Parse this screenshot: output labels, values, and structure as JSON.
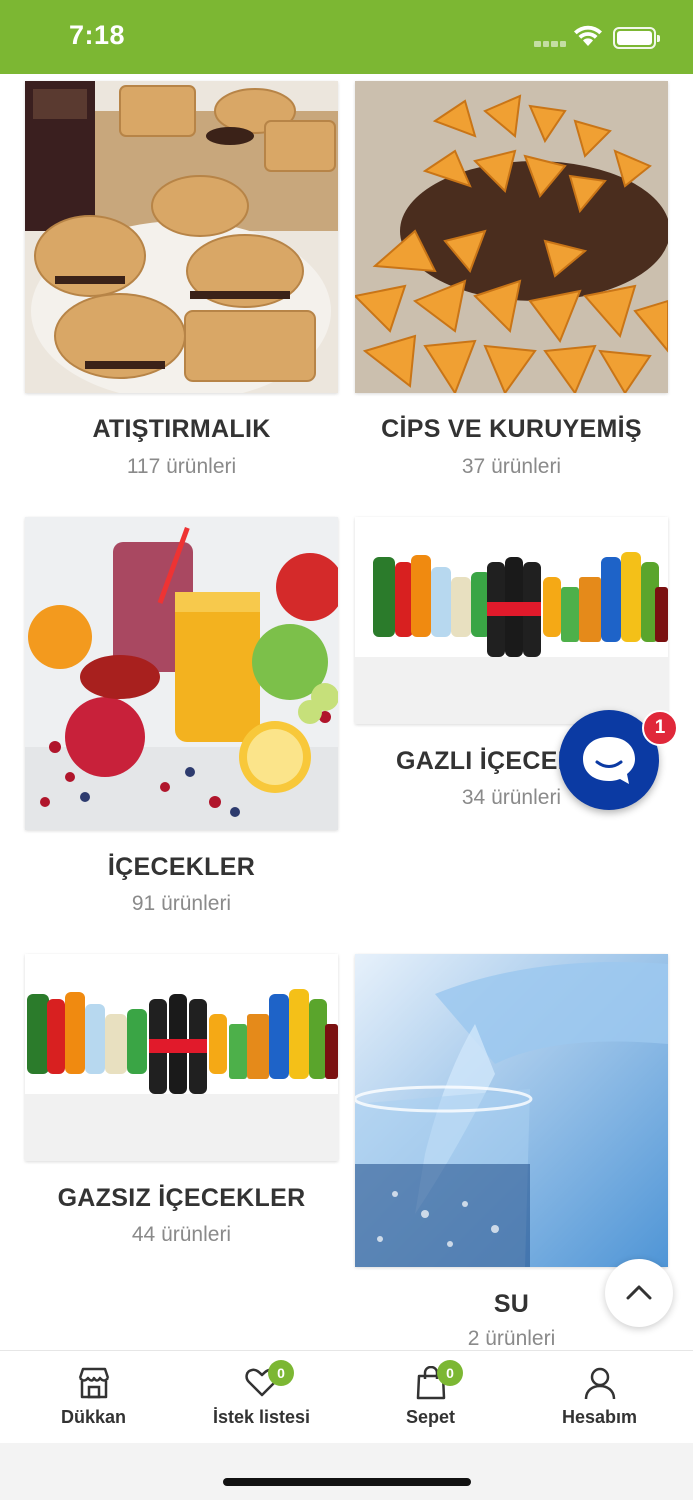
{
  "status_bar": {
    "time": "7:18"
  },
  "categories": [
    {
      "name": "ATIŞTIRMALIK",
      "count": "117 ürünleri",
      "image": "biscuits"
    },
    {
      "name": "CİPS VE KURUYEMİŞ",
      "count": "37 ürünleri",
      "image": "chips"
    },
    {
      "name": "İÇECEKLER",
      "count": "91 ürünleri",
      "image": "juices"
    },
    {
      "name": "GAZLI İÇECEKLER",
      "count": "34 ürünleri",
      "image": "soda-bottles"
    },
    {
      "name": "GAZSIZ İÇECEKLER",
      "count": "44 ürünleri",
      "image": "soda-bottles"
    },
    {
      "name": "SU",
      "count": "2 ürünleri",
      "image": "water-glass"
    }
  ],
  "chat": {
    "badge": "1"
  },
  "bottom_nav": {
    "items": [
      {
        "label": "Dükkan",
        "icon": "store-icon"
      },
      {
        "label": "İstek listesi",
        "icon": "heart-icon",
        "badge": "0"
      },
      {
        "label": "Sepet",
        "icon": "shopping-bag-icon",
        "badge": "0"
      },
      {
        "label": "Hesabım",
        "icon": "user-icon"
      }
    ]
  },
  "colors": {
    "brand": "#7cb733",
    "chat": "#0b3aa3",
    "badge_red": "#e0283a"
  }
}
